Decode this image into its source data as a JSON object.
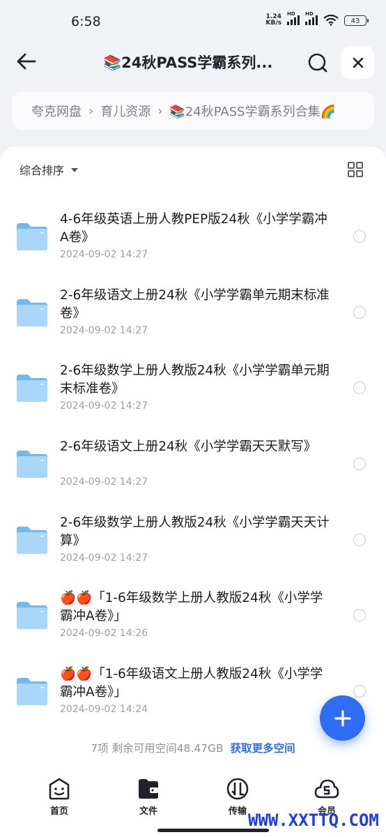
{
  "status_bar": {
    "time": "6:58",
    "net_speed_value": "1.24",
    "net_speed_unit": "KB/s",
    "hd_label": "HD",
    "battery": "43"
  },
  "header": {
    "title": "📚24秋PASS学霸系列..."
  },
  "breadcrumb": {
    "items": [
      "夸克网盘",
      "育儿资源",
      "📚24秋PASS学霸系列合集🌈"
    ],
    "separator": "›"
  },
  "toolbar": {
    "sort_label": "综合排序"
  },
  "files": [
    {
      "name": "4-6年级英语上册人教PEP版24秋《小学学霸冲A卷》",
      "date": "2024-09-02 14:27"
    },
    {
      "name": "2-6年级语文上册24秋《小学学霸单元期末标准卷》",
      "date": "2024-09-02 14:27"
    },
    {
      "name": "2-6年级数学上册人教版24秋《小学学霸单元期末标准卷》",
      "date": "2024-09-02 14:27"
    },
    {
      "name": "2-6年级语文上册24秋《小学学霸天天默写》",
      "date": "2024-09-02 14:27"
    },
    {
      "name": "2-6年级数学上册人教版24秋《小学学霸天天计算》",
      "date": "2024-09-02 14:27"
    },
    {
      "name": "🍎🍎「1-6年级数学上册人教版24秋《小学学霸冲A卷》」",
      "date": "2024-09-02 14:26"
    },
    {
      "name": "🍎🍎「1-6年级语文上册人教版24秋《小学学霸冲A卷》」",
      "date": "2024-09-02 14:24"
    }
  ],
  "summary": {
    "text": "7项 剩余可用空间48.47GB",
    "link": "获取更多空间"
  },
  "bottom_nav": {
    "items": [
      {
        "label": "首页",
        "icon": "home-face-icon"
      },
      {
        "label": "文件",
        "icon": "folder-wallet-icon"
      },
      {
        "label": "传输",
        "icon": "transfer-icon"
      },
      {
        "label": "会员",
        "icon": "member-cloud-icon"
      }
    ]
  },
  "watermark": "WWW.XXTTQ.COM",
  "colors": {
    "accent": "#2f6df6",
    "folder": "#8cc8f7",
    "background": "#f0f2f6"
  }
}
